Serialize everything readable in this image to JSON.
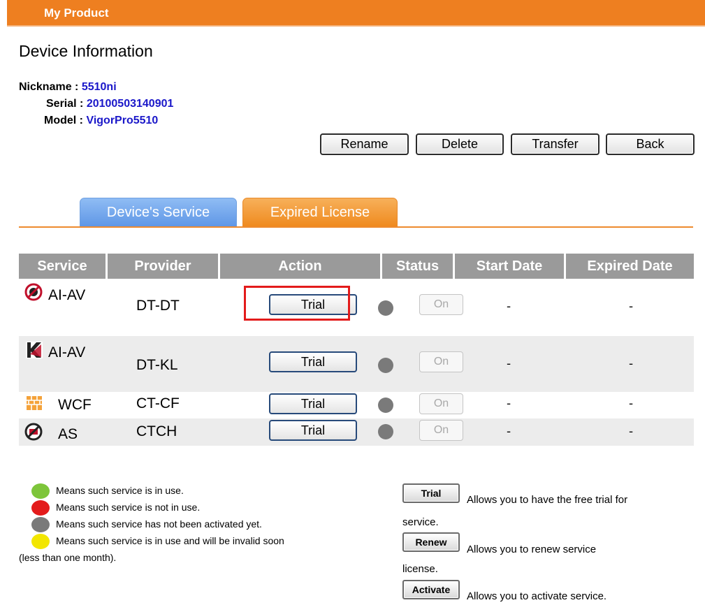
{
  "header": {
    "title": "My Product"
  },
  "section": {
    "title": "Device Information"
  },
  "device": {
    "nickname_label": "Nickname :",
    "nickname": "5510ni",
    "serial_label": "Serial :",
    "serial": "20100503140901",
    "model_label": "Model :",
    "model": "VigorPro5510"
  },
  "actions": {
    "rename": "Rename",
    "delete": "Delete",
    "transfer": "Transfer",
    "back": "Back"
  },
  "tabs": {
    "devices_service": "Device's Service",
    "expired_license": "Expired License"
  },
  "table": {
    "headers": [
      "Service",
      "Provider",
      "Action",
      "Status",
      "Start Date",
      "Expired Date"
    ],
    "rows": [
      {
        "service": "AI-AV",
        "icon": "anti-virus-icon",
        "provider": "DT-DT",
        "action": "Trial",
        "status": "On",
        "start": "-",
        "expired": "-"
      },
      {
        "service": "AI-AV",
        "icon": "kaspersky-icon",
        "provider": "DT-KL",
        "action": "Trial",
        "status": "On",
        "start": "-",
        "expired": "-"
      },
      {
        "service": "WCF",
        "icon": "firewall-icon",
        "provider": "CT-CF",
        "action": "Trial",
        "status": "On",
        "start": "-",
        "expired": "-"
      },
      {
        "service": "AS",
        "icon": "anti-spam-icon",
        "provider": "CTCH",
        "action": "Trial",
        "status": "On",
        "start": "-",
        "expired": "-"
      }
    ]
  },
  "legend": {
    "green": "Means such service is in use.",
    "red": "Means such service is not in use.",
    "gray": "Means such service has not been activated yet.",
    "yellow_1": "Means such service is in use and will be invalid soon",
    "yellow_2": "(less than one month).",
    "colors": {
      "green": "#7dc53a",
      "red": "#e31b1b",
      "gray": "#7a7a7a",
      "yellow": "#f2e600"
    }
  },
  "buttons_help": {
    "trial_label": "Trial",
    "trial_desc_1": "Allows you to have the free trial for",
    "trial_desc_2": "service.",
    "renew_label": "Renew",
    "renew_desc_1": "Allows you to renew service",
    "renew_desc_2": "license.",
    "activate_label": "Activate",
    "activate_desc": "Allows you to activate service."
  },
  "colors": {
    "accent": "#ee7f20",
    "link": "#1a17c9",
    "highlight": "#e31b1b"
  }
}
